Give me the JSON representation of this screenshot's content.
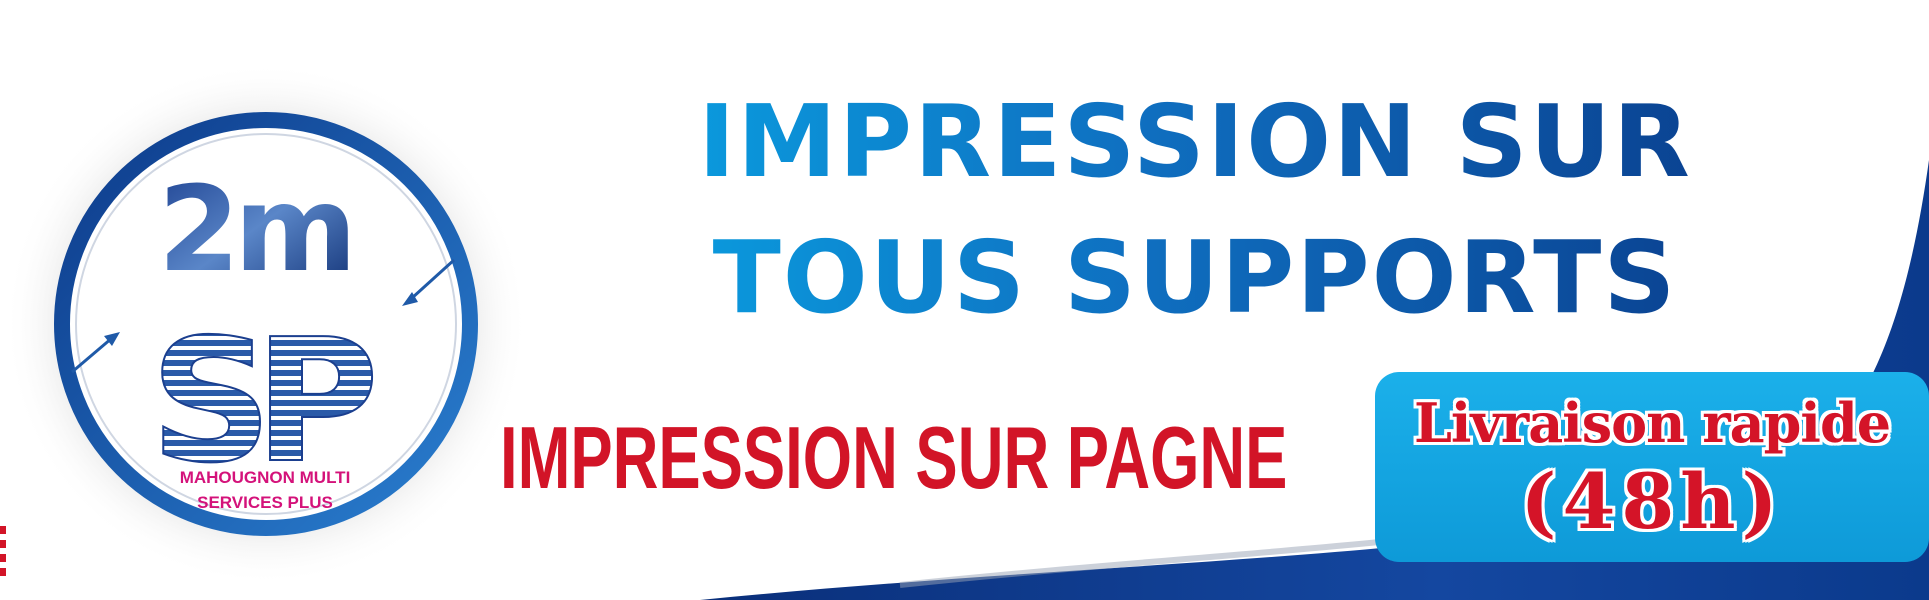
{
  "colors": {
    "headline_start": "#0a9ee0",
    "headline_end": "#0a3f8e",
    "subheadline": "#d21427",
    "badge_bg": "#1bb0ea",
    "badge_text": "#d41428",
    "logo_ring": "#1a4fa0",
    "company_name": "#d4127a"
  },
  "logo": {
    "monogram_top": "2m",
    "monogram_bottom": "SP",
    "company_line1": "MAHOUGNON MULTI",
    "company_line2": "SERVICES PLUS",
    "icons": [
      "arrow-left-icon",
      "arrow-right-icon"
    ]
  },
  "headline": {
    "line1": "IMPRESSION SUR",
    "line2": "TOUS SUPPORTS"
  },
  "subheadline": "IMPRESSION SUR PAGNE",
  "badge": {
    "line1": "Livraison rapide",
    "line2": "(48h)"
  }
}
